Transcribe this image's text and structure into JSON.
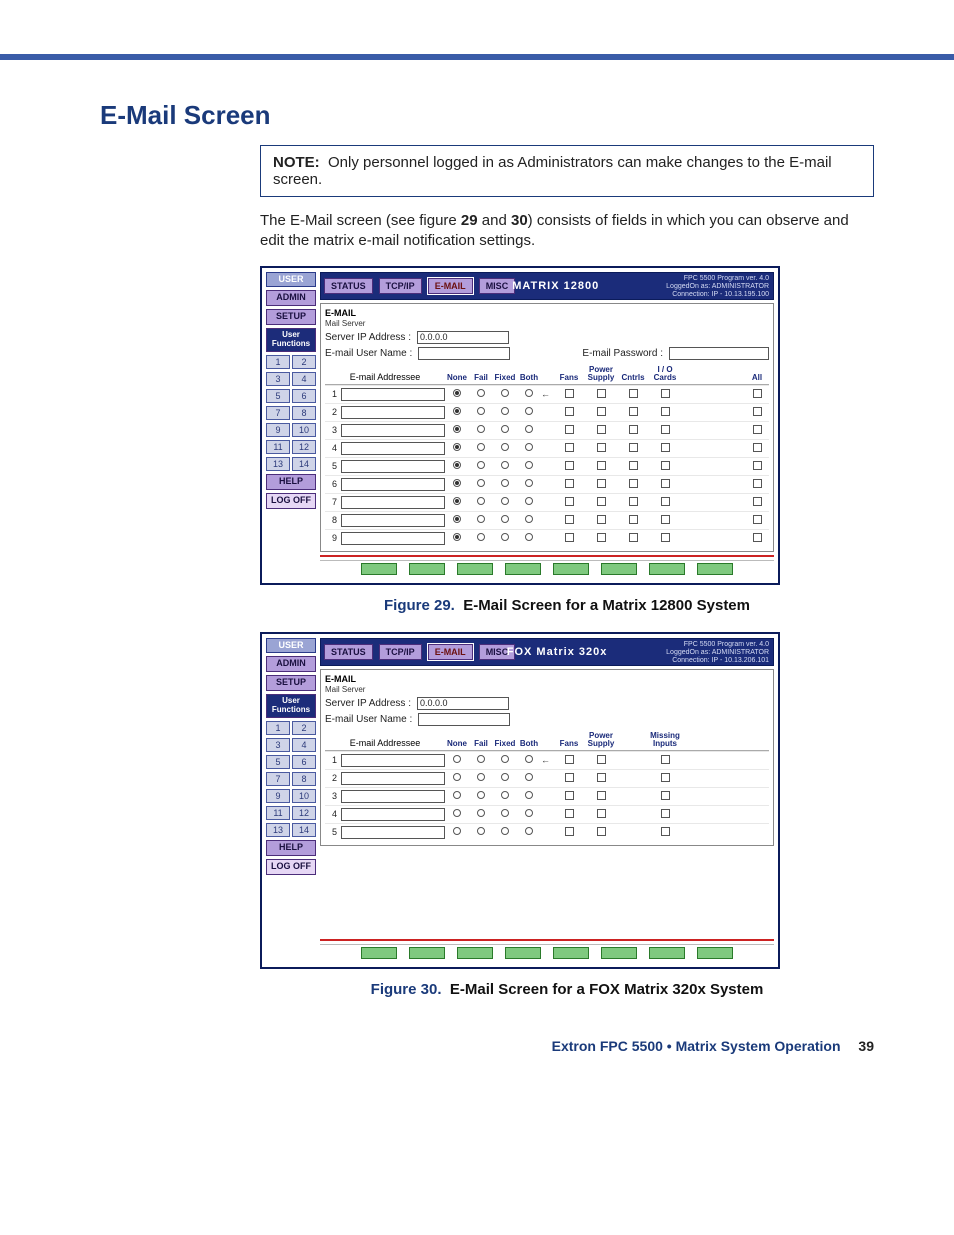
{
  "page": {
    "section_title": "E-Mail Screen",
    "note_label": "NOTE:",
    "note_text": "Only personnel logged in as Administrators can make changes to the E-mail screen.",
    "intro_a": "The E-Mail screen (see figure ",
    "intro_fig1": "29",
    "intro_mid": " and ",
    "intro_fig2": "30",
    "intro_b": ") consists of fields in which you can observe and edit the matrix e-mail notification settings."
  },
  "sidebar": {
    "user": "USER",
    "admin": "ADMIN",
    "setup": "SETUP",
    "user_functions": "User Functions",
    "help": "HELP",
    "logoff": "LOG OFF",
    "pairs": [
      [
        "1",
        "2"
      ],
      [
        "3",
        "4"
      ],
      [
        "5",
        "6"
      ],
      [
        "7",
        "8"
      ],
      [
        "9",
        "10"
      ],
      [
        "11",
        "12"
      ],
      [
        "13",
        "14"
      ]
    ]
  },
  "tabs": {
    "status": "STATUS",
    "tcpip": "TCP/IP",
    "email": "E-MAIL",
    "misc": "MISC"
  },
  "screen_common": {
    "email_legend": "E-MAIL",
    "mail_server": "Mail Server",
    "server_ip_label": "Server IP Address :",
    "server_ip_value": "0.0.0.0",
    "user_label": "E-mail User Name :",
    "pwd_label": "E-mail Password :",
    "addr_label": "E-mail Addressee",
    "none": "None",
    "fail": "Fail",
    "fixed": "Fixed",
    "both": "Both",
    "program": "FPC 5500 Program  ver. 4.0",
    "logged": "LoggedOn as: ADMINISTRATOR"
  },
  "screen1": {
    "matrix_name": "MATRIX 12800",
    "conn": "Connection: IP - 10.13.195.100",
    "headers": {
      "fans": "Fans",
      "power": "Power Supply",
      "cntrls": "Cntrls",
      "io": "I / O Cards",
      "all": "All"
    },
    "rows": [
      "1",
      "2",
      "3",
      "4",
      "5",
      "6",
      "7",
      "8",
      "9"
    ]
  },
  "screen2": {
    "matrix_name": "FOX Matrix 320x",
    "conn": "Connection: IP - 10.13.206.101",
    "headers": {
      "fans": "Fans",
      "power": "Power Supply",
      "missing": "Missing Inputs"
    },
    "rows": [
      "1",
      "2",
      "3",
      "4",
      "5"
    ]
  },
  "captions": {
    "fig29_num": "Figure 29.",
    "fig29_title": "E-Mail Screen for a Matrix 12800 System",
    "fig30_num": "Figure 30.",
    "fig30_title": "E-Mail Screen for a FOX Matrix 320x System"
  },
  "footer": {
    "product": "Extron FPC 5500 • Matrix System Operation",
    "page_no": "39"
  }
}
